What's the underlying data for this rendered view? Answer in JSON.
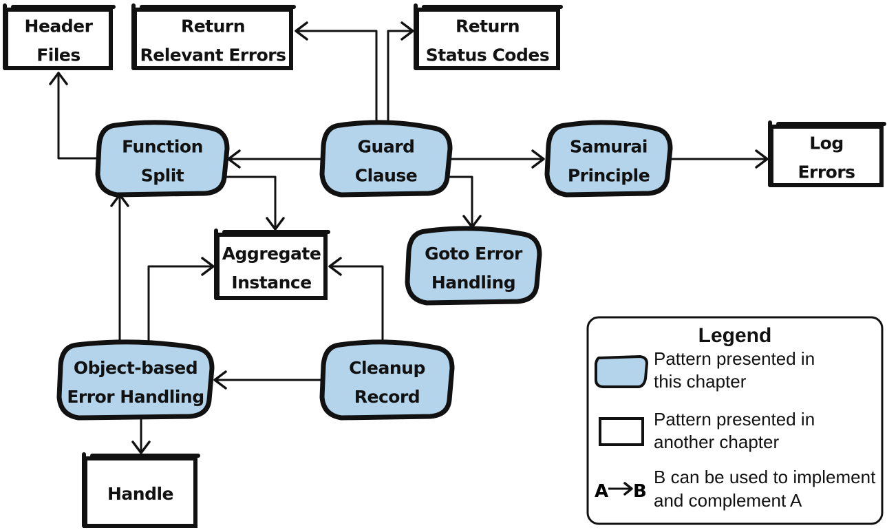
{
  "colors": {
    "pattern_fill": "#b3d4ea",
    "outline": "#111111",
    "background": "#ffffff"
  },
  "nodes": [
    {
      "id": "header-files",
      "kind": "other-chapter",
      "lines": [
        "Header",
        "Files"
      ]
    },
    {
      "id": "return-relevant-errors",
      "kind": "other-chapter",
      "lines": [
        "Return",
        "Relevant Errors"
      ]
    },
    {
      "id": "return-status-codes",
      "kind": "other-chapter",
      "lines": [
        "Return",
        "Status Codes"
      ]
    },
    {
      "id": "function-split",
      "kind": "this-chapter",
      "lines": [
        "Function",
        "Split"
      ]
    },
    {
      "id": "guard-clause",
      "kind": "this-chapter",
      "lines": [
        "Guard",
        "Clause"
      ]
    },
    {
      "id": "samurai-principle",
      "kind": "this-chapter",
      "lines": [
        "Samurai",
        "Principle"
      ]
    },
    {
      "id": "log-errors",
      "kind": "other-chapter",
      "lines": [
        "Log",
        "Errors"
      ]
    },
    {
      "id": "aggregate-instance",
      "kind": "other-chapter",
      "lines": [
        "Aggregate",
        "Instance"
      ]
    },
    {
      "id": "goto-error-handling",
      "kind": "this-chapter",
      "lines": [
        "Goto Error",
        "Handling"
      ]
    },
    {
      "id": "object-based-error-handling",
      "kind": "this-chapter",
      "lines": [
        "Object-based",
        "Error Handling"
      ]
    },
    {
      "id": "cleanup-record",
      "kind": "this-chapter",
      "lines": [
        "Cleanup",
        "Record"
      ]
    },
    {
      "id": "handle",
      "kind": "other-chapter",
      "lines": [
        "Handle"
      ]
    }
  ],
  "edges": [
    {
      "from": "guard-clause",
      "to": "return-relevant-errors"
    },
    {
      "from": "guard-clause",
      "to": "return-status-codes"
    },
    {
      "from": "guard-clause",
      "to": "function-split"
    },
    {
      "from": "guard-clause",
      "to": "samurai-principle"
    },
    {
      "from": "guard-clause",
      "to": "goto-error-handling"
    },
    {
      "from": "samurai-principle",
      "to": "log-errors"
    },
    {
      "from": "function-split",
      "to": "header-files"
    },
    {
      "from": "function-split",
      "to": "aggregate-instance"
    },
    {
      "from": "object-based-error-handling",
      "to": "function-split"
    },
    {
      "from": "object-based-error-handling",
      "to": "aggregate-instance"
    },
    {
      "from": "object-based-error-handling",
      "to": "handle"
    },
    {
      "from": "cleanup-record",
      "to": "aggregate-instance"
    },
    {
      "from": "cleanup-record",
      "to": "object-based-error-handling"
    }
  ],
  "legend": {
    "title": "Legend",
    "items": [
      {
        "symbol": "rounded-blue-shape",
        "lines": [
          "Pattern presented in",
          "this chapter"
        ]
      },
      {
        "symbol": "rectangle",
        "lines": [
          "Pattern presented in",
          "another chapter"
        ]
      },
      {
        "symbol": "arrow",
        "symbol_text": [
          "A",
          "B"
        ],
        "lines": [
          "B can be used to implement",
          "and complement A"
        ]
      }
    ]
  }
}
